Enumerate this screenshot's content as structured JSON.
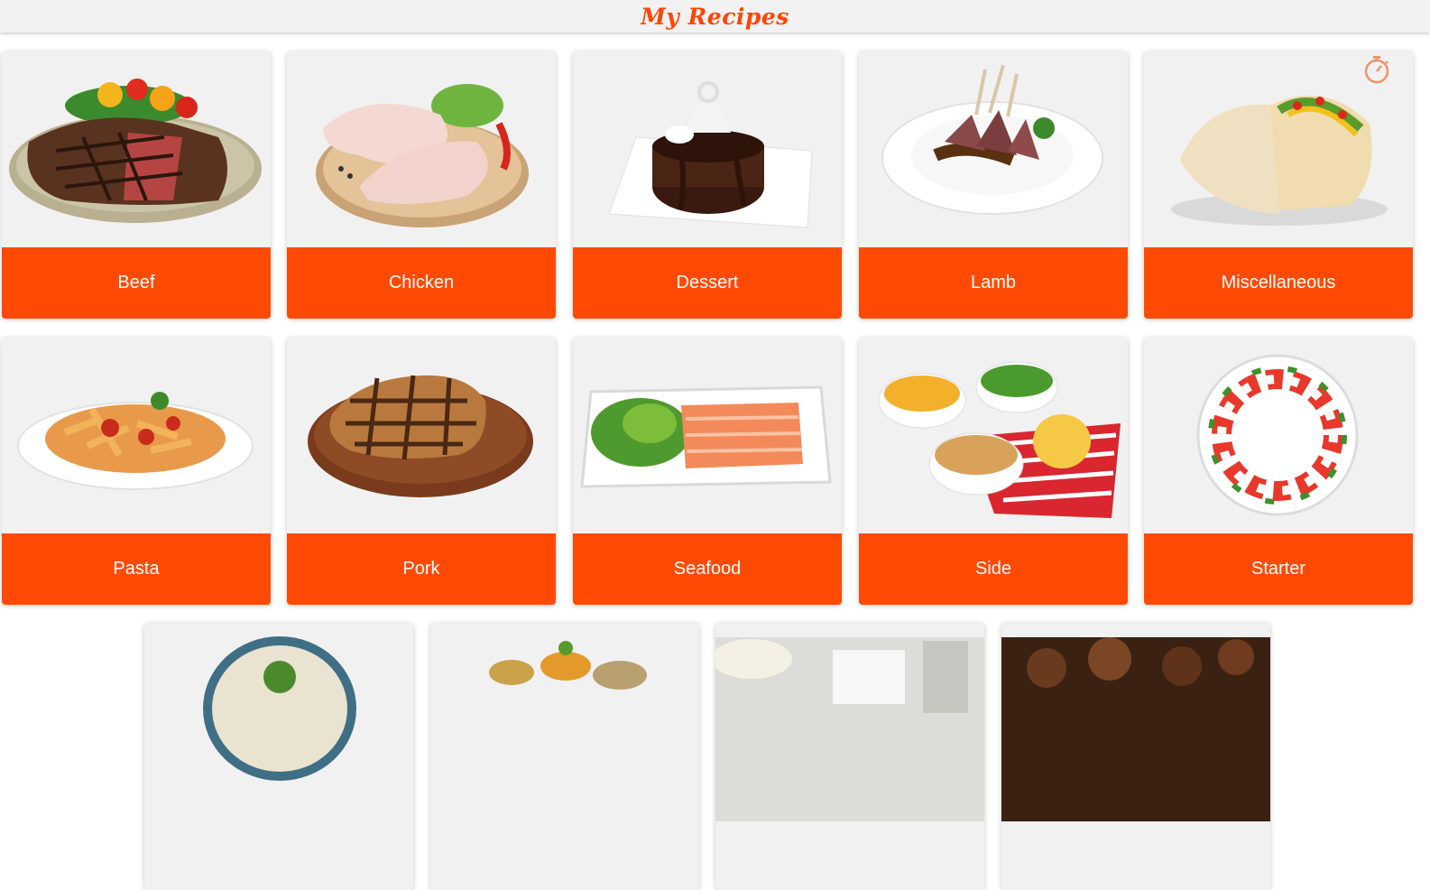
{
  "header": {
    "title": "My Recipes"
  },
  "colors": {
    "accent": "#ff4a05",
    "card_bg": "#f1f1f1",
    "header_bg": "#f2f2f2"
  },
  "categories": [
    {
      "label": "Beef",
      "icon": "steak-image"
    },
    {
      "label": "Chicken",
      "icon": "chicken-image"
    },
    {
      "label": "Dessert",
      "icon": "cake-image"
    },
    {
      "label": "Lamb",
      "icon": "lamb-image"
    },
    {
      "label": "Miscellaneous",
      "icon": "taco-image"
    },
    {
      "label": "Pasta",
      "icon": "pasta-image"
    },
    {
      "label": "Pork",
      "icon": "pork-image"
    },
    {
      "label": "Seafood",
      "icon": "salmon-image"
    },
    {
      "label": "Side",
      "icon": "sides-image"
    },
    {
      "label": "Starter",
      "icon": "caprese-image"
    }
  ],
  "timer_icon": "stopwatch-icon"
}
